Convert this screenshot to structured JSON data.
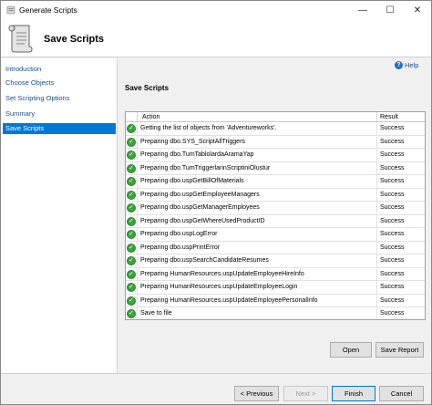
{
  "window": {
    "title": "Generate Scripts",
    "controls": {
      "minimize": "—",
      "maximize": "☐",
      "close": "✕"
    }
  },
  "header": {
    "title": "Save Scripts"
  },
  "sidebar": {
    "items": [
      {
        "label": "Introduction",
        "active": false
      },
      {
        "label": "Choose Objects",
        "active": false
      },
      {
        "label": "Set Scripting Options",
        "active": false
      },
      {
        "label": "Summary",
        "active": false
      },
      {
        "label": "Save Scripts",
        "active": true
      }
    ]
  },
  "main": {
    "help_label": "Help",
    "section_title": "Save Scripts",
    "grid": {
      "columns": {
        "action": "Action",
        "result": "Result"
      },
      "status_icon": "success-check-icon",
      "rows": [
        {
          "action": "Getting the list of objects from 'Adventureworks'.",
          "result": "Success"
        },
        {
          "action": "Preparing dbo.SYS_ScriptAllTriggers",
          "result": "Success"
        },
        {
          "action": "Preparing dbo.TumTablolardaAramaYap",
          "result": "Success"
        },
        {
          "action": "Preparing dbo.TumTriggerlarinScriptiniOlustur",
          "result": "Success"
        },
        {
          "action": "Preparing dbo.uspGetBillOfMaterials",
          "result": "Success"
        },
        {
          "action": "Preparing dbo.uspGetEmployeeManagers",
          "result": "Success"
        },
        {
          "action": "Preparing dbo.uspGetManagerEmployees",
          "result": "Success"
        },
        {
          "action": "Preparing dbo.uspGetWhereUsedProductID",
          "result": "Success"
        },
        {
          "action": "Preparing dbo.uspLogError",
          "result": "Success"
        },
        {
          "action": "Preparing dbo.uspPrintError",
          "result": "Success"
        },
        {
          "action": "Preparing dbo.uspSearchCandidateResumes",
          "result": "Success"
        },
        {
          "action": "Preparing HumanResources.uspUpdateEmployeeHireInfo",
          "result": "Success"
        },
        {
          "action": "Preparing HumanResources.uspUpdateEmployeeLogin",
          "result": "Success"
        },
        {
          "action": "Preparing HumanResources.uspUpdateEmployeePersonalInfo",
          "result": "Success"
        },
        {
          "action": "Save to file",
          "result": "Success"
        }
      ]
    },
    "open_label": "Open",
    "save_report_label": "Save Report"
  },
  "footer": {
    "previous_label": "< Previous",
    "next_label": "Next >",
    "finish_label": "Finish",
    "cancel_label": "Cancel"
  },
  "colors": {
    "accent": "#0078d7",
    "link": "#1a4f8b",
    "success": "#3aa53a"
  }
}
